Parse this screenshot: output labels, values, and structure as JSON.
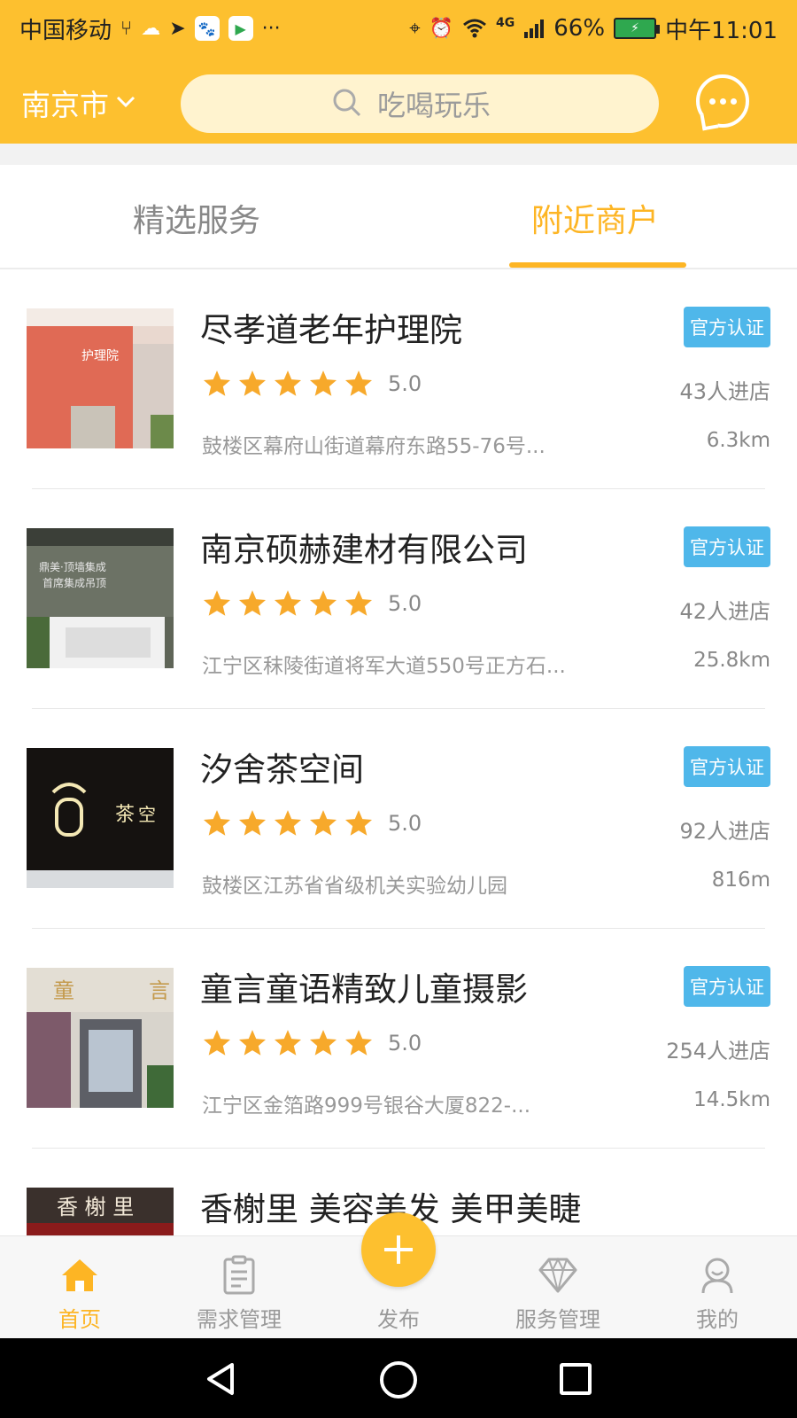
{
  "status_bar": {
    "carrier": "中国移动",
    "network": "4G",
    "battery": "66%",
    "time": "中午11:01"
  },
  "header": {
    "city": "南京市",
    "search_placeholder": "吃喝玩乐"
  },
  "tabs": [
    {
      "label": "精选服务",
      "active": false
    },
    {
      "label": "附近商户",
      "active": true
    }
  ],
  "merchants": [
    {
      "name": "尽孝道老年护理院",
      "badge": "官方认证",
      "rating": "5.0",
      "visits": "43人进店",
      "address": "鼓楼区幕府山街道幕府东路55-76号...",
      "distance": "6.3km"
    },
    {
      "name": "南京硕赫建材有限公司",
      "badge": "官方认证",
      "rating": "5.0",
      "visits": "42人进店",
      "address": "江宁区秣陵街道将军大道550号正方石...",
      "distance": "25.8km"
    },
    {
      "name": "汐舍茶空间",
      "badge": "官方认证",
      "rating": "5.0",
      "visits": "92人进店",
      "address": "鼓楼区江苏省省级机关实验幼儿园",
      "distance": "816m"
    },
    {
      "name": "童言童语精致儿童摄影",
      "badge": "官方认证",
      "rating": "5.0",
      "visits": "254人进店",
      "address": "江宁区金箔路999号银谷大厦822-...",
      "distance": "14.5km"
    },
    {
      "name": "香榭里 美容美发 美甲美睫",
      "badge": "",
      "rating": "",
      "visits": "",
      "address": "",
      "distance": ""
    }
  ],
  "bottom_nav": [
    {
      "label": "首页",
      "icon": "home-icon",
      "active": true
    },
    {
      "label": "需求管理",
      "icon": "clipboard-icon",
      "active": false
    },
    {
      "label": "发布",
      "icon": "plus-icon",
      "active": false
    },
    {
      "label": "服务管理",
      "icon": "diamond-icon",
      "active": false
    },
    {
      "label": "我的",
      "icon": "user-icon",
      "active": false
    }
  ],
  "colors": {
    "accent": "#FDC02F",
    "tab_active": "#FDB524",
    "badge": "#4FB7EA",
    "star": "#F7A92B"
  }
}
